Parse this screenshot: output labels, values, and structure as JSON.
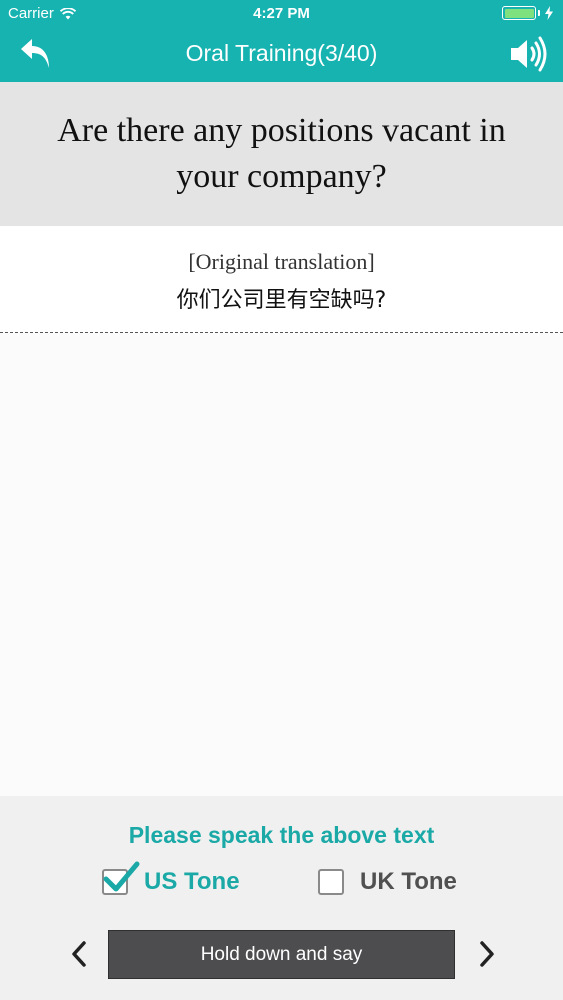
{
  "status_bar": {
    "carrier": "Carrier",
    "time": "4:27 PM",
    "battery_level": 1.0,
    "battery_color": "#7ee07e"
  },
  "nav": {
    "title": "Oral Training(3/40)",
    "back_icon": "back-arrow-icon",
    "speaker_icon": "speaker-icon",
    "bar_color": "#17b3b0"
  },
  "question": {
    "text": "Are there any positions vacant in your company?"
  },
  "translation": {
    "label": "[Original translation]",
    "text": "你们公司里有空缺吗?"
  },
  "controls": {
    "prompt": "Please speak the above text",
    "us_tone": {
      "label": "US Tone",
      "checked": true
    },
    "uk_tone": {
      "label": "UK Tone",
      "checked": false
    },
    "hold_button": "Hold down and say",
    "prev_icon": "chevron-left-icon",
    "next_icon": "chevron-right-icon",
    "accent_color": "#1aa9a6"
  }
}
